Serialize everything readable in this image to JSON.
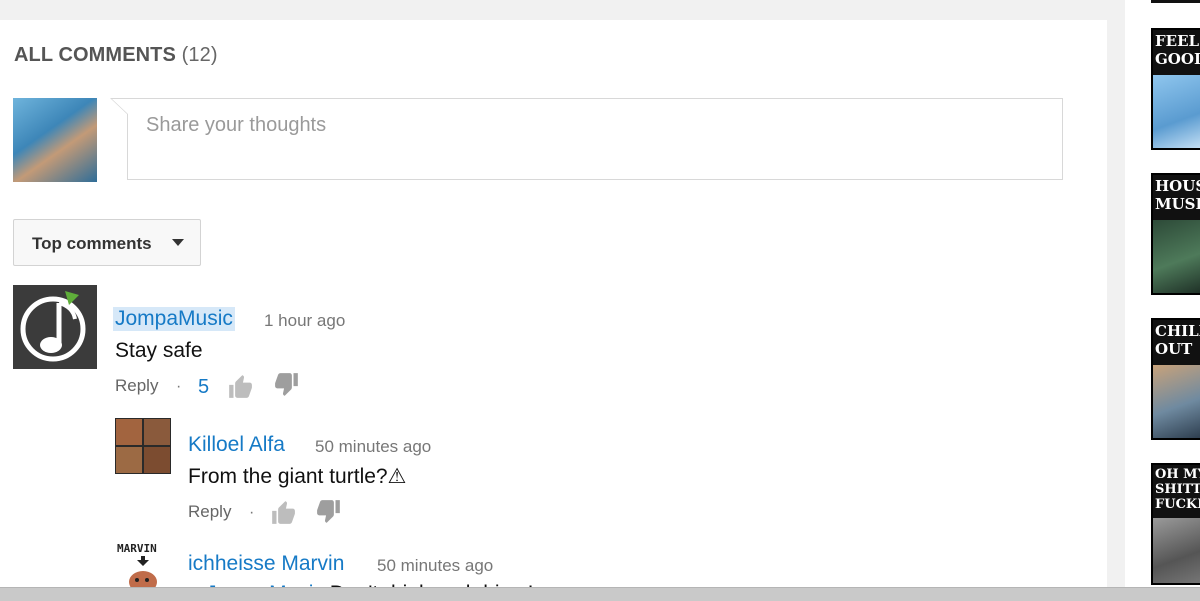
{
  "comments_section": {
    "header_label": "ALL COMMENTS",
    "header_count": "(12)",
    "share_placeholder": "Share your thoughts",
    "sort_label": "Top comments"
  },
  "comments": [
    {
      "author": "JompaMusic",
      "time": "1 hour ago",
      "text": "Stay safe",
      "reply_label": "Reply",
      "separator": "·",
      "likes": "5"
    },
    {
      "author": "Killoel Alfa",
      "time": "50 minutes ago",
      "text": "From the giant turtle?⚠",
      "reply_label": "Reply",
      "separator": "·"
    },
    {
      "author": "ichheisse Marvin",
      "time": "50 minutes ago",
      "mention": "+ JompaMusic",
      "text": " Don't drink and drive !",
      "avatar_text": "MARVIN"
    }
  ],
  "sidebar": {
    "thumbnails": [
      {
        "title": "FEEL\nGOOD"
      },
      {
        "title": "HOUS\nMUSI"
      },
      {
        "title": "CHILL\nOUT"
      },
      {
        "title": "OH MY\nSHITTI\nFUCKK"
      }
    ]
  },
  "colors": {
    "link_blue": "#167ac6",
    "panel_bg": "#ffffff",
    "page_bg": "#f1f1f1"
  }
}
